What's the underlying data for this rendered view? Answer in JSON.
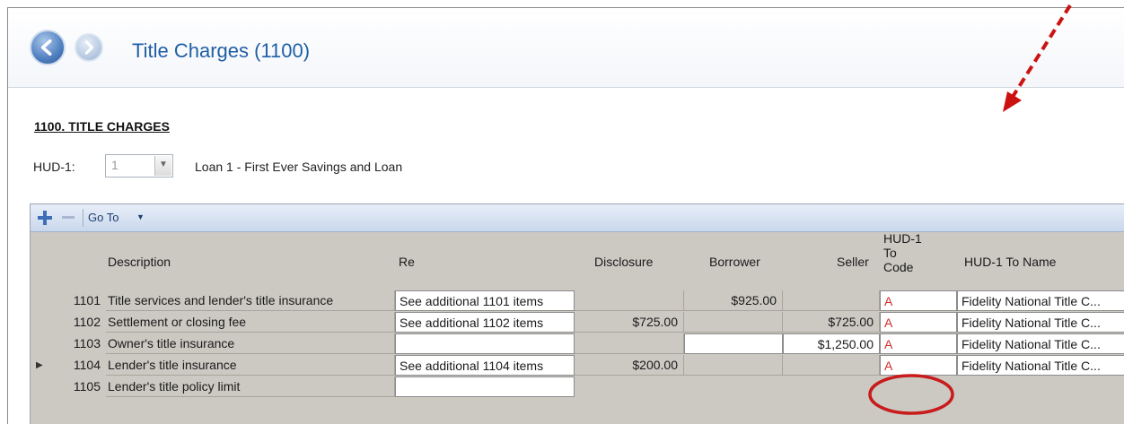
{
  "header": {
    "title": "Title Charges (1100)"
  },
  "section": {
    "title": "1100. TITLE CHARGES",
    "hud_label": "HUD-1:",
    "hud_value": "1",
    "loan_text": "Loan 1 - First Ever Savings and Loan"
  },
  "toolbar": {
    "add_label": "+",
    "remove_label": "−",
    "goto_label": "Go To"
  },
  "columns": {
    "description": "Description",
    "re": "Re",
    "disclosure": "Disclosure",
    "borrower": "Borrower",
    "seller": "Seller",
    "hud_code_1": "HUD-1",
    "hud_code_2": "To",
    "hud_code_3": "Code",
    "hud_name": "HUD-1 To Name"
  },
  "rows": [
    {
      "num": "1101",
      "description": "Title services and lender's title insurance",
      "re": "See additional 1101 items",
      "disclosure": "",
      "borrower": "$925.00",
      "seller": "",
      "code": "A",
      "name": "Fidelity National Title C..."
    },
    {
      "num": "1102",
      "description": "Settlement or closing fee",
      "re": "See additional 1102 items",
      "disclosure": "$725.00",
      "borrower": "",
      "seller": "$725.00",
      "code": "A",
      "name": "Fidelity National Title C..."
    },
    {
      "num": "1103",
      "description": "Owner's title insurance",
      "re": "",
      "disclosure": "",
      "borrower": "",
      "seller": "$1,250.00",
      "code": "A",
      "name": "Fidelity National Title C..."
    },
    {
      "num": "1104",
      "description": "Lender's title insurance",
      "re": "See additional 1104 items",
      "disclosure": "$200.00",
      "borrower": "",
      "seller": "",
      "code": "A",
      "name": "Fidelity National Title C..."
    },
    {
      "num": "1105",
      "description": "Lender's title policy limit",
      "re": "",
      "disclosure": "",
      "borrower": "",
      "seller": "",
      "code": "",
      "name": ""
    }
  ],
  "colors": {
    "accent": "#1f5fa6",
    "annotation": "#cc1111"
  }
}
